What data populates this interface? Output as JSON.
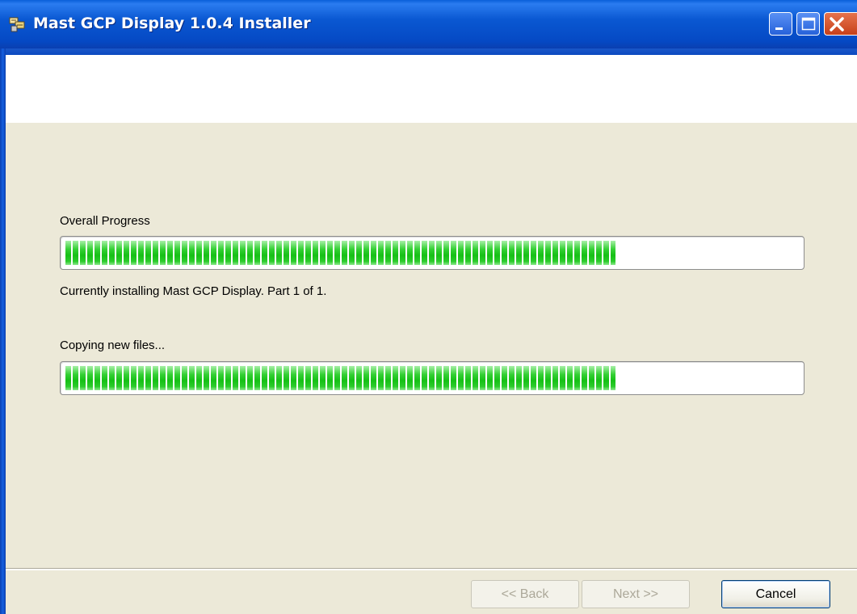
{
  "window": {
    "title": "Mast GCP Display 1.0.4 Installer",
    "icon": "installer-icon",
    "controls": [
      "minimize-icon",
      "maximize-icon",
      "close-icon"
    ]
  },
  "progress": {
    "overall_label": "Overall Progress",
    "overall_fraction": 0.75,
    "status_text": "Currently installing Mast GCP Display.  Part 1 of 1.",
    "action_label": "Copying new files...",
    "action_fraction": 0.75
  },
  "footer": {
    "back_label": "<< Back",
    "next_label": "Next >>",
    "cancel_label": "Cancel"
  },
  "colors": {
    "titlebar": "#0a58d2",
    "progress_fill": "#22c822",
    "dialog_bg": "#ece9d8",
    "close_button": "#d6542a"
  }
}
